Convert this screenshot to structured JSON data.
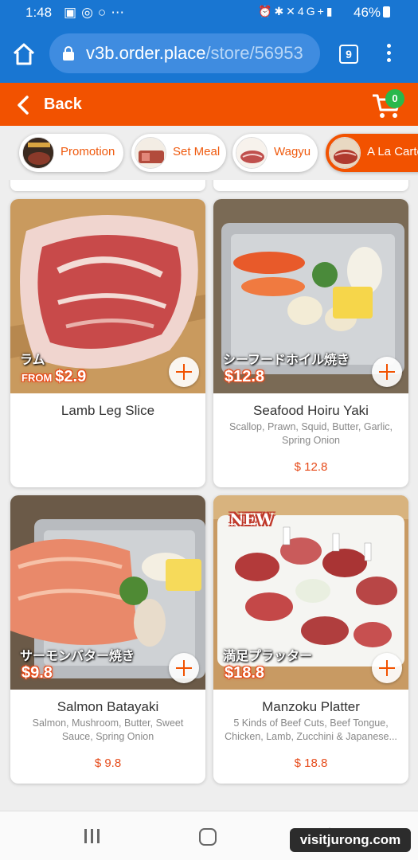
{
  "status_bar": {
    "time": "1:48",
    "left_icons": [
      "image-icon",
      "whatsapp-icon",
      "circle-icon",
      "more-dots-icon"
    ],
    "right_icons": [
      "alarm-icon",
      "bluetooth-icon",
      "mute-icon",
      "network-4g-icon",
      "signal-icon"
    ],
    "network_label": "4G+",
    "battery": "46%"
  },
  "browser": {
    "url_host": "v3b.order.place",
    "url_path": "/store/56953",
    "tab_count": "9"
  },
  "header": {
    "back_label": "Back",
    "cart_count": "0"
  },
  "categories": [
    {
      "label": "Promotion",
      "thumb_text": "PROMOTION",
      "active": false
    },
    {
      "label": "Set Meal",
      "thumb_text": "SET MEAL",
      "active": false
    },
    {
      "label": "Wagyu",
      "thumb_text": "WAGYU",
      "active": false
    },
    {
      "label": "A La Carte",
      "thumb_text": "A LA CARTE",
      "active": true
    }
  ],
  "products": [
    {
      "name": "Lamb Leg Slice",
      "description": "",
      "price": "",
      "image_label": "ラム",
      "image_price_prefix": "FROM",
      "image_price": "$2.9"
    },
    {
      "name": "Seafood Hoiru Yaki",
      "description": "Scallop, Prawn, Squid, Butter, Garlic, Spring Onion",
      "price": "$ 12.8",
      "image_label": "シーフードホイル焼き",
      "image_price_prefix": "",
      "image_price": "$12.8"
    },
    {
      "name": "Salmon Batayaki",
      "description": "Salmon, Mushroom, Butter, Sweet Sauce, Spring Onion",
      "price": "$ 9.8",
      "image_label": "サーモンバター焼き",
      "image_price_prefix": "",
      "image_price": "$9.8"
    },
    {
      "name": "Manzoku Platter",
      "description": "5 Kinds of Beef Cuts, Beef Tongue, Chicken, Lamb, Zucchini & Japanese...",
      "price": "$ 18.8",
      "image_label": "満足プラッター",
      "image_price_prefix": "",
      "image_price": "$18.8",
      "badge": "NEW"
    }
  ],
  "watermark": "visitjurong.com",
  "colors": {
    "brand_orange": "#f25200",
    "browser_blue": "#1976d2",
    "cart_badge_green": "#29b84b",
    "price_orange": "#e64a19"
  }
}
